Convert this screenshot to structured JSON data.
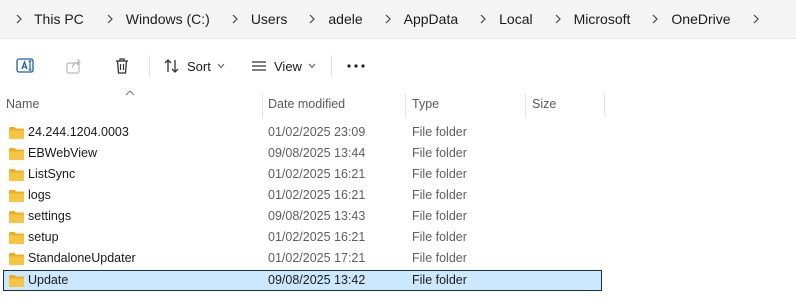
{
  "breadcrumb": {
    "items": [
      "This PC",
      "Windows (C:)",
      "Users",
      "adele",
      "AppData",
      "Local",
      "Microsoft",
      "OneDrive"
    ]
  },
  "commandbar": {
    "sort_label": "Sort",
    "view_label": "View"
  },
  "columns": {
    "name": "Name",
    "date_modified": "Date modified",
    "type": "Type",
    "size": "Size"
  },
  "files": [
    {
      "name": "24.244.1204.0003",
      "date": "01/02/2025 23:09",
      "type": "File folder",
      "size": ""
    },
    {
      "name": "EBWebView",
      "date": "09/08/2025 13:44",
      "type": "File folder",
      "size": ""
    },
    {
      "name": "ListSync",
      "date": "01/02/2025 16:21",
      "type": "File folder",
      "size": ""
    },
    {
      "name": "logs",
      "date": "01/02/2025 16:21",
      "type": "File folder",
      "size": ""
    },
    {
      "name": "settings",
      "date": "09/08/2025 13:43",
      "type": "File folder",
      "size": ""
    },
    {
      "name": "setup",
      "date": "01/02/2025 16:21",
      "type": "File folder",
      "size": ""
    },
    {
      "name": "StandaloneUpdater",
      "date": "01/02/2025 17:21",
      "type": "File folder",
      "size": ""
    },
    {
      "name": "Update",
      "date": "09/08/2025 13:42",
      "type": "File folder",
      "size": "",
      "selected": true
    }
  ],
  "icons": {
    "chevron": "chevron-right-icon",
    "rename": "rename-icon",
    "share": "share-icon",
    "delete": "trash-icon",
    "sort": "sort-icon",
    "view": "view-icon",
    "more": "more-icon",
    "folder": "folder-icon"
  },
  "colors": {
    "selection_bg": "#cce8ff",
    "selection_border": "#1b2e4a",
    "folder_yellow": "#f8c542",
    "accent": "#005fb8"
  }
}
